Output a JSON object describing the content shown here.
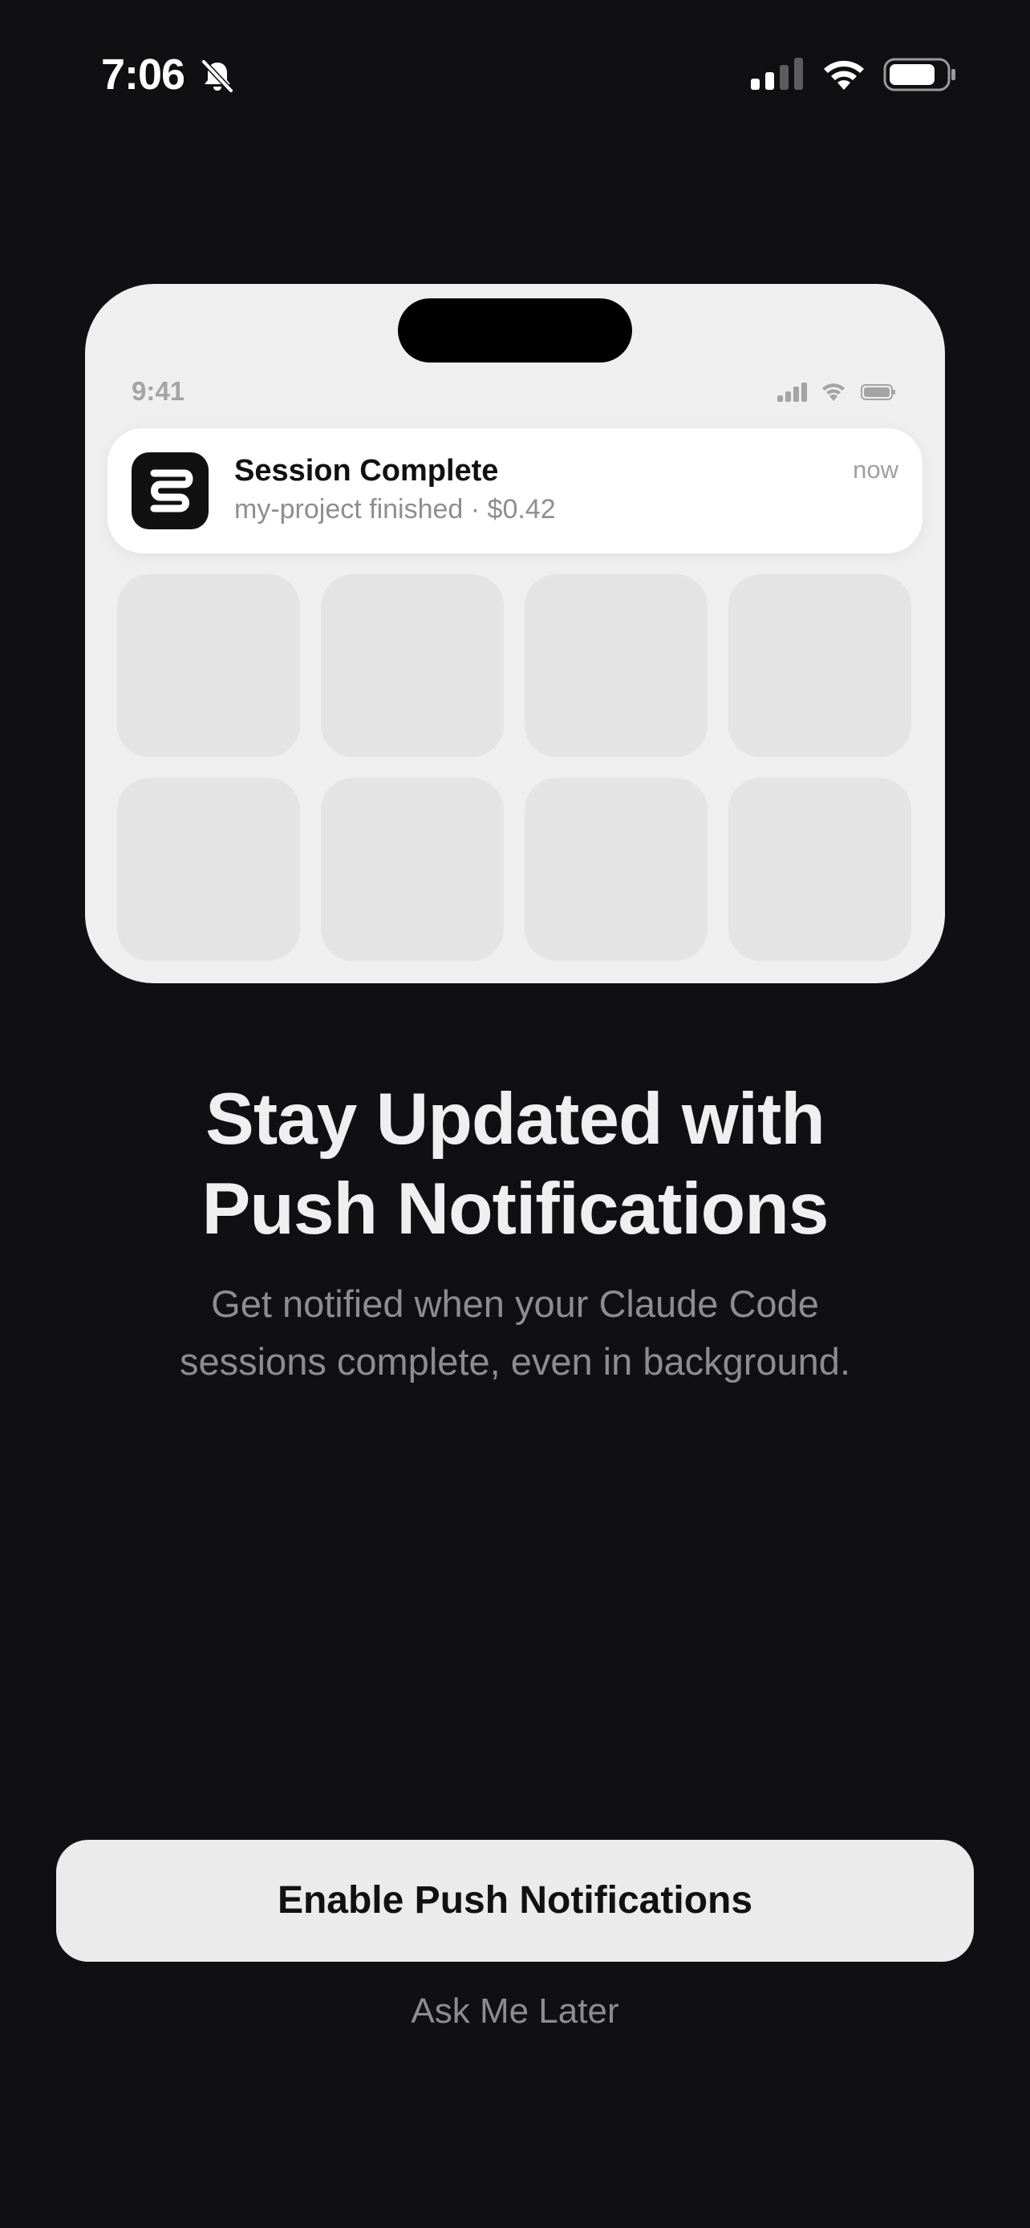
{
  "status_bar": {
    "time": "7:06",
    "icons": [
      "bell-slash-icon",
      "cellular-signal-icon",
      "wifi-icon",
      "battery-icon"
    ]
  },
  "preview": {
    "status_time": "9:41",
    "notification": {
      "app_icon": "claude-code-app-icon",
      "title": "Session Complete",
      "body": "my-project finished · $0.42",
      "time": "now"
    },
    "app_grid_count": 8
  },
  "content": {
    "headline_line1": "Stay Updated with",
    "headline_line2": "Push Notifications",
    "subtitle_line1": "Get notified when your Claude Code",
    "subtitle_line2": "sessions complete, even in background."
  },
  "actions": {
    "enable_label": "Enable Push Notifications",
    "later_label": "Ask Me Later"
  },
  "colors": {
    "background": "#101012",
    "card": "#efefef",
    "button": "#ebebeb",
    "secondary_text": "#8c8c91"
  }
}
